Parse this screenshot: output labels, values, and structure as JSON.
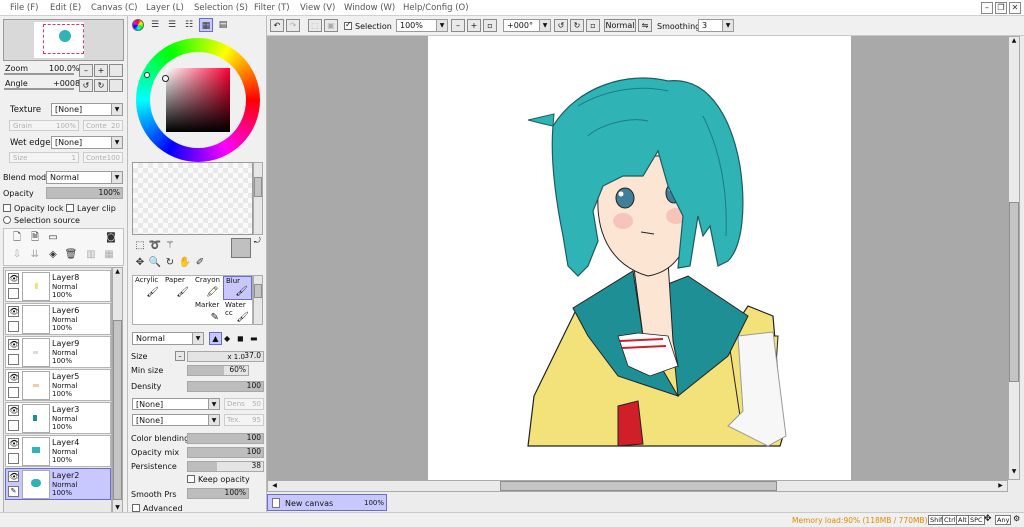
{
  "menu": [
    {
      "label": "File (F)"
    },
    {
      "label": "Edit (E)"
    },
    {
      "label": "Canvas (C)"
    },
    {
      "label": "Layer (L)"
    },
    {
      "label": "Selection (S)"
    },
    {
      "label": "Filter (T)"
    },
    {
      "label": "View (V)"
    },
    {
      "label": "Window (W)"
    },
    {
      "label": "Help/Config (O)"
    }
  ],
  "navigator": {
    "zoom_label": "Zoom",
    "zoom_value": "100.0%",
    "angle_label": "Angle",
    "angle_value": "+0008"
  },
  "texture": {
    "texture_label": "Texture",
    "texture_value": "[None]",
    "grain_label": "Grain",
    "grain_value": "100%",
    "conte_label": "Conte",
    "conte_value": "20",
    "wetedge_label": "Wet edge",
    "wetedge_value": "[None]",
    "size_label": "Size",
    "size_value": "1",
    "conte2_label": "Conte",
    "conte2_value": "100"
  },
  "layer_props": {
    "blend_label": "Blend mode",
    "blend_value": "Normal",
    "opacity_label": "Opacity",
    "opacity_value": "100%",
    "opacity_fraction": 1.0,
    "opacity_lock": "Opacity lock",
    "layer_clip": "Layer clip",
    "selection_source": "Selection source"
  },
  "layers": [
    {
      "name": "Layer8",
      "mode": "Normal",
      "opacity": "100%",
      "selected": false
    },
    {
      "name": "Layer6",
      "mode": "Normal",
      "opacity": "100%",
      "selected": false
    },
    {
      "name": "Layer9",
      "mode": "Normal",
      "opacity": "100%",
      "selected": false
    },
    {
      "name": "Layer5",
      "mode": "Normal",
      "opacity": "100%",
      "selected": false
    },
    {
      "name": "Layer3",
      "mode": "Normal",
      "opacity": "100%",
      "selected": false
    },
    {
      "name": "Layer4",
      "mode": "Normal",
      "opacity": "100%",
      "selected": false
    },
    {
      "name": "Layer2",
      "mode": "Normal",
      "opacity": "100%",
      "selected": true
    }
  ],
  "brushes": [
    {
      "name": "Acrylic",
      "selected": false
    },
    {
      "name": "Paper",
      "selected": false
    },
    {
      "name": "Crayon",
      "selected": false
    },
    {
      "name": "Blur",
      "selected": true
    },
    {
      "name": "Marker",
      "selected": false
    },
    {
      "name": "Water cc",
      "selected": false
    }
  ],
  "brush_settings": {
    "mode_value": "Normal",
    "size_label": "Size",
    "size_mult": "x 1.0",
    "size_value": "37.0",
    "minsize_label": "Min size",
    "minsize_value": "60%",
    "minsize_fraction": 0.6,
    "density_label": "Density",
    "density_value": "100",
    "density_fraction": 1.0,
    "tex1_value": "[None]",
    "tex1_side_label": "Dens",
    "tex1_side_value": "50",
    "tex2_value": "[None]",
    "tex2_side_label": "Tex.",
    "tex2_side_value": "95",
    "colorblend_label": "Color blending",
    "colorblend_value": "100",
    "colorblend_fraction": 1.0,
    "opmix_label": "Opacity mix",
    "opmix_value": "100",
    "opmix_fraction": 1.0,
    "persist_label": "Persistence",
    "persist_value": "38",
    "persist_fraction": 0.38,
    "keep_opacity": "Keep opacity",
    "smooth_label": "Smooth Prs",
    "smooth_value": "100%",
    "smooth_fraction": 1.0,
    "advanced": "Advanced"
  },
  "toolbar": {
    "selection_label": "Selection",
    "zoom_value": "100%",
    "angle_value": "+000°",
    "mode_value": "Normal",
    "smoothing_label": "Smoothing",
    "smoothing_value": "3"
  },
  "document_tab": {
    "name": "New canvas",
    "zoom": "100%"
  },
  "status": {
    "memory": "Memory load:90% (118MB / 770MB)",
    "keys": [
      "Shift",
      "Ctrl",
      "Alt",
      "SPC",
      "Any"
    ]
  },
  "colors": {
    "selection_highlight": "#c8c8ff",
    "canvas_background": "#a9a9a9",
    "memory_text": "#e08a00",
    "hair": "#2fb3b5",
    "jacket": "#f3e27a",
    "collar": "#1f8f96",
    "tie": "#d11f2a"
  }
}
